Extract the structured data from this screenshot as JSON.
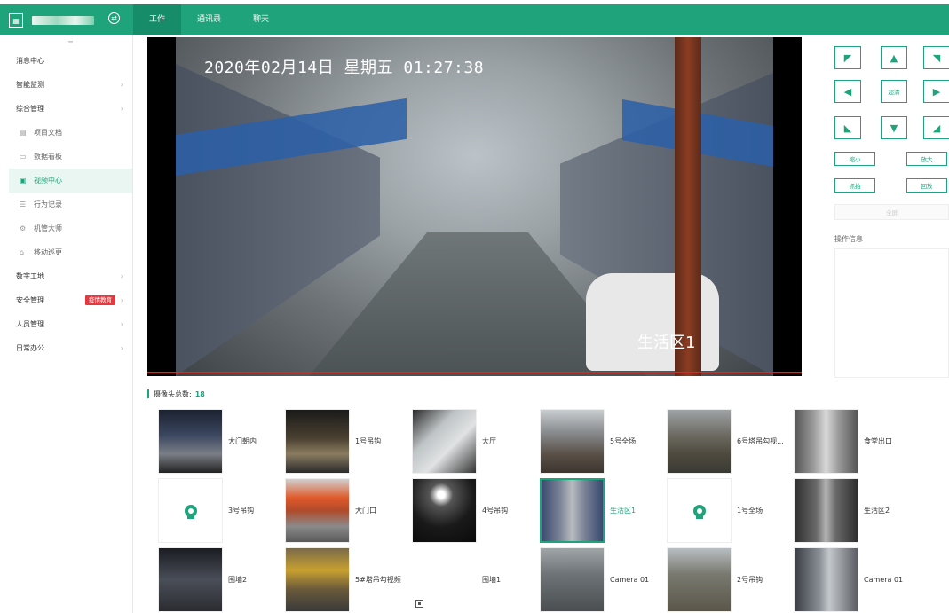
{
  "topbar": {
    "nav": [
      "工作",
      "通讯录",
      "聊天"
    ],
    "active_index": 0,
    "accent_color": "#1fa37a"
  },
  "sidebar": {
    "items": [
      {
        "label": "消息中心",
        "type": "top"
      },
      {
        "label": "智能监测",
        "type": "group"
      },
      {
        "label": "综合管理",
        "type": "group"
      },
      {
        "label": "项目文档",
        "type": "sub",
        "icon": "document-icon"
      },
      {
        "label": "数据看板",
        "type": "sub",
        "icon": "dashboard-icon"
      },
      {
        "label": "视频中心",
        "type": "sub",
        "icon": "video-icon",
        "active": true
      },
      {
        "label": "行为记录",
        "type": "sub",
        "icon": "record-icon"
      },
      {
        "label": "机管大师",
        "type": "sub",
        "icon": "machine-icon"
      },
      {
        "label": "移动巡更",
        "type": "sub",
        "icon": "patrol-icon"
      },
      {
        "label": "数字工地",
        "type": "group"
      },
      {
        "label": "安全管理",
        "type": "group",
        "badge": "疫情教育"
      },
      {
        "label": "人员管理",
        "type": "group"
      },
      {
        "label": "日常办公",
        "type": "group"
      }
    ]
  },
  "video": {
    "osd_time": "2020年02月14日  星期五  01:27:38",
    "osd_label": "生活区1"
  },
  "ptz": {
    "center_label": "超清",
    "zoom_out": "缩小",
    "zoom_in": "放大",
    "capture": "抓拍",
    "playback": "回放",
    "disabled_button": "全屏",
    "op_info_label": "操作信息"
  },
  "cameras": {
    "count_label": "摄像头总数:",
    "count": "18",
    "items": [
      {
        "name": "大门朝内",
        "thumb": "night-gate"
      },
      {
        "name": "1号吊钩",
        "thumb": "crane-night"
      },
      {
        "name": "大厅",
        "thumb": "hall"
      },
      {
        "name": "5号全场",
        "thumb": "site-day"
      },
      {
        "name": "6号塔吊勾视...",
        "thumb": "tower-day"
      },
      {
        "name": "食堂出口",
        "thumb": "canteen"
      },
      {
        "name": "3号吊钩",
        "thumb": "offline"
      },
      {
        "name": "大门口",
        "thumb": "gate-tent"
      },
      {
        "name": "4号吊钩",
        "thumb": "lights-night"
      },
      {
        "name": "生活区1",
        "thumb": "living",
        "selected": true
      },
      {
        "name": "1号全场",
        "thumb": "offline"
      },
      {
        "name": "生活区2",
        "thumb": "corridor"
      },
      {
        "name": "围墙2",
        "thumb": "wall-night"
      },
      {
        "name": "5#塔吊勾视频",
        "thumb": "tower-yellow"
      },
      {
        "name": "围墙1",
        "thumb": "broken"
      },
      {
        "name": "Camera 01",
        "thumb": "street"
      },
      {
        "name": "2号吊钩",
        "thumb": "crane-day"
      },
      {
        "name": "Camera 01",
        "thumb": "alley"
      }
    ]
  }
}
